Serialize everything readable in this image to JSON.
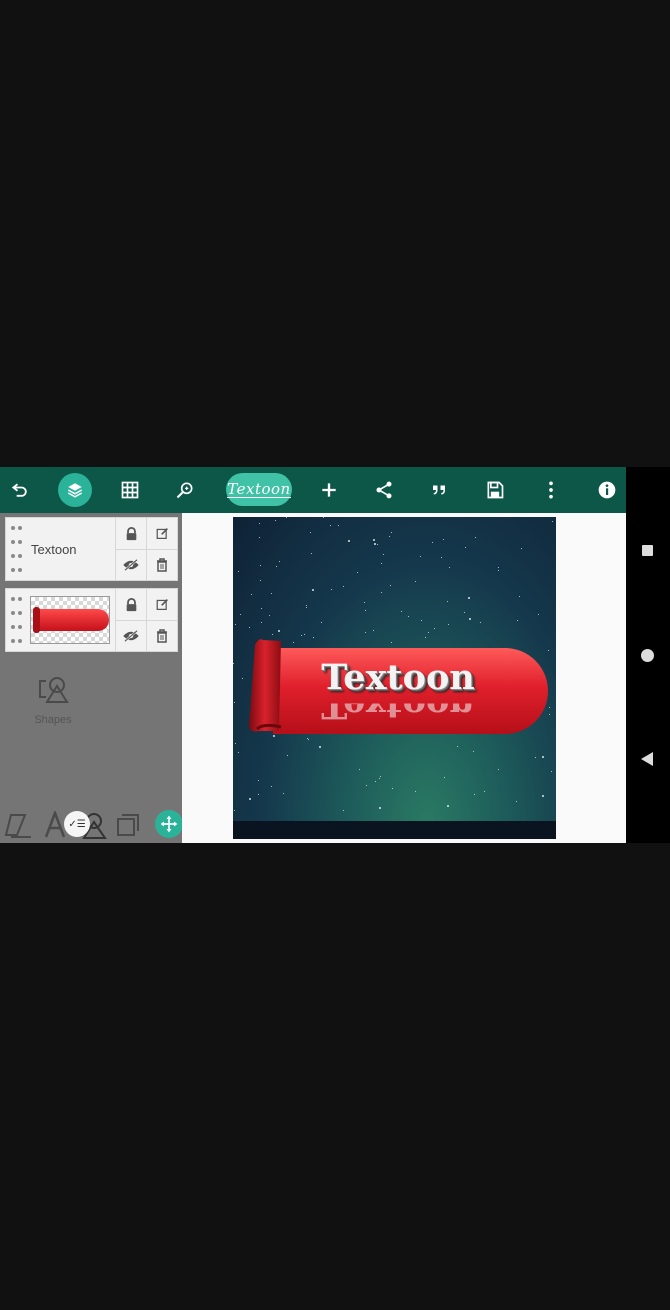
{
  "app": {
    "logo_text": "Textoon",
    "accent_color": "#0d5748",
    "active_color": "#2bb39a"
  },
  "toolbar": {
    "icons": [
      "undo-icon",
      "layers-icon",
      "grid-icon",
      "zoom-icon",
      "logo",
      "add-icon",
      "share-icon",
      "quote-icon",
      "save-icon",
      "more-icon",
      "info-icon"
    ]
  },
  "layers": [
    {
      "type": "text",
      "label": "Textoon"
    },
    {
      "type": "image",
      "label": ""
    }
  ],
  "side_panel": {
    "shapes_label": "Shapes"
  },
  "canvas": {
    "banner_text": "Textoon",
    "banner_color": "#e0202c"
  }
}
